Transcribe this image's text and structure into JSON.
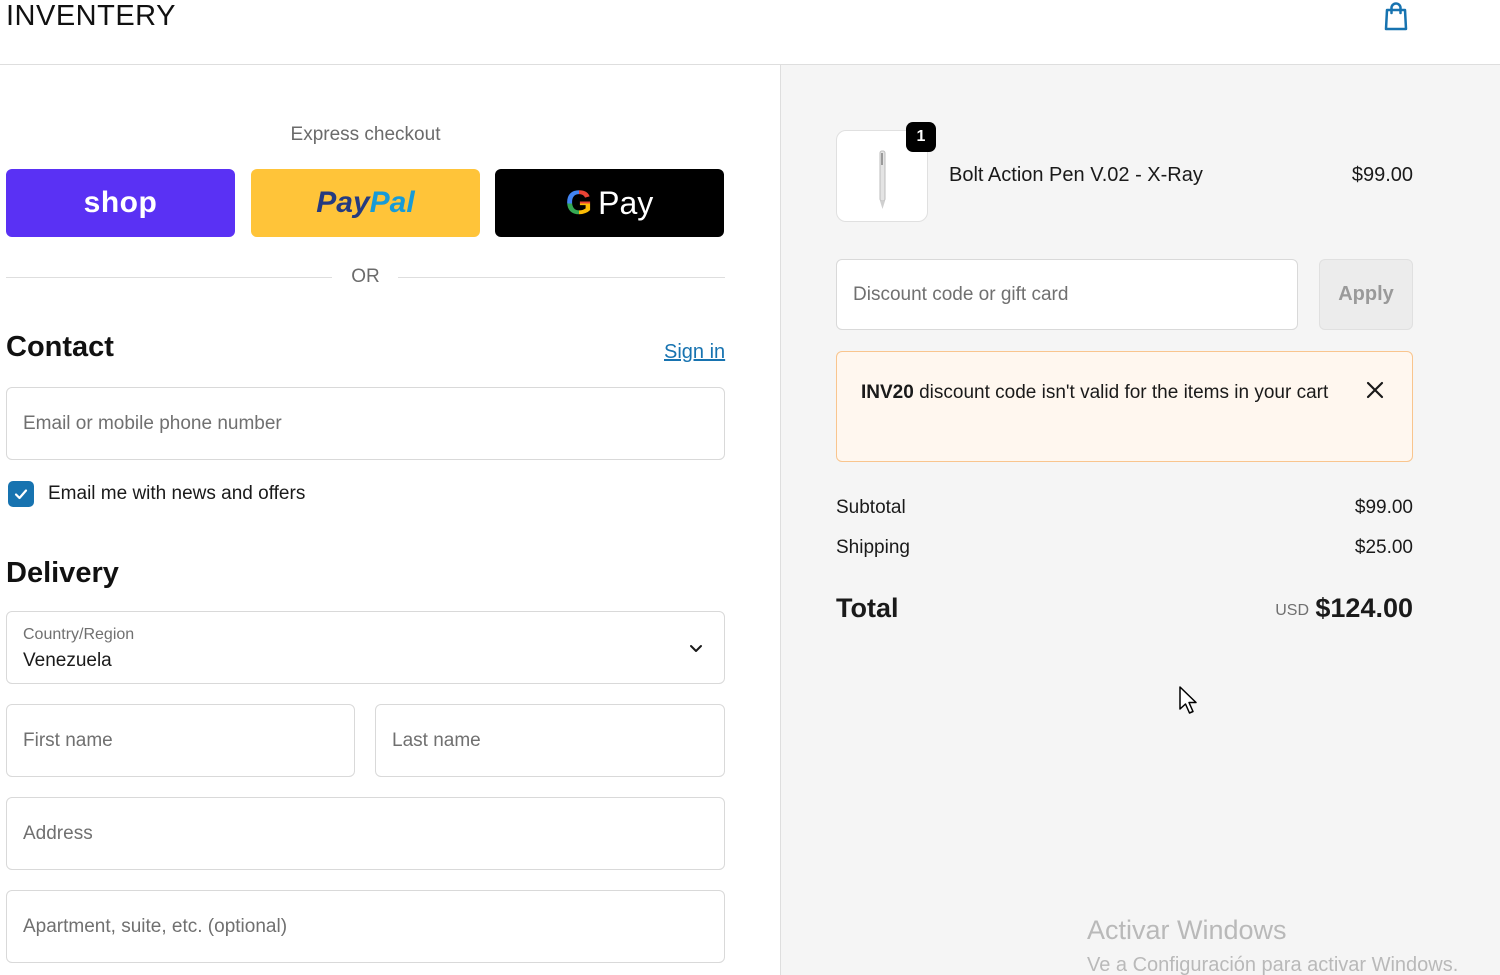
{
  "header": {
    "brand": "INVENTERY",
    "cart_icon": "shopping-bag-icon"
  },
  "express": {
    "label": "Express checkout",
    "shop_label": "shop",
    "paypal_label_1": "Pay",
    "paypal_label_2": "Pal",
    "gpay_g": "G",
    "gpay_label": "Pay",
    "or_label": "OR"
  },
  "contact": {
    "title": "Contact",
    "sign_in": "Sign in",
    "email_placeholder": "Email or mobile phone number",
    "news_label": "Email me with news and offers",
    "news_checked": true
  },
  "delivery": {
    "title": "Delivery",
    "country_label": "Country/Region",
    "country_value": "Venezuela",
    "first_name_placeholder": "First name",
    "last_name_placeholder": "Last name",
    "address_placeholder": "Address",
    "apartment_placeholder": "Apartment, suite, etc. (optional)"
  },
  "summary": {
    "item": {
      "quantity": "1",
      "name": "Bolt Action Pen V.02 - X-Ray",
      "price": "$99.00"
    },
    "discount_placeholder": "Discount code or gift card",
    "apply_label": "Apply",
    "alert": {
      "code": "INV20",
      "message": " discount code isn't valid for the items in your cart"
    },
    "subtotal_label": "Subtotal",
    "subtotal_value": "$99.00",
    "shipping_label": "Shipping",
    "shipping_value": "$25.00",
    "total_label": "Total",
    "total_currency": "USD",
    "total_value": "$124.00"
  },
  "watermark": {
    "line1": "Activar Windows",
    "line2": "Ve a Configuración para activar Windows."
  },
  "colors": {
    "shop": "#5a31f4",
    "paypal": "#ffc439",
    "gpay": "#000000",
    "link": "#1773b0",
    "alert_bg": "#fff7ef",
    "alert_border": "#f9c58e"
  }
}
